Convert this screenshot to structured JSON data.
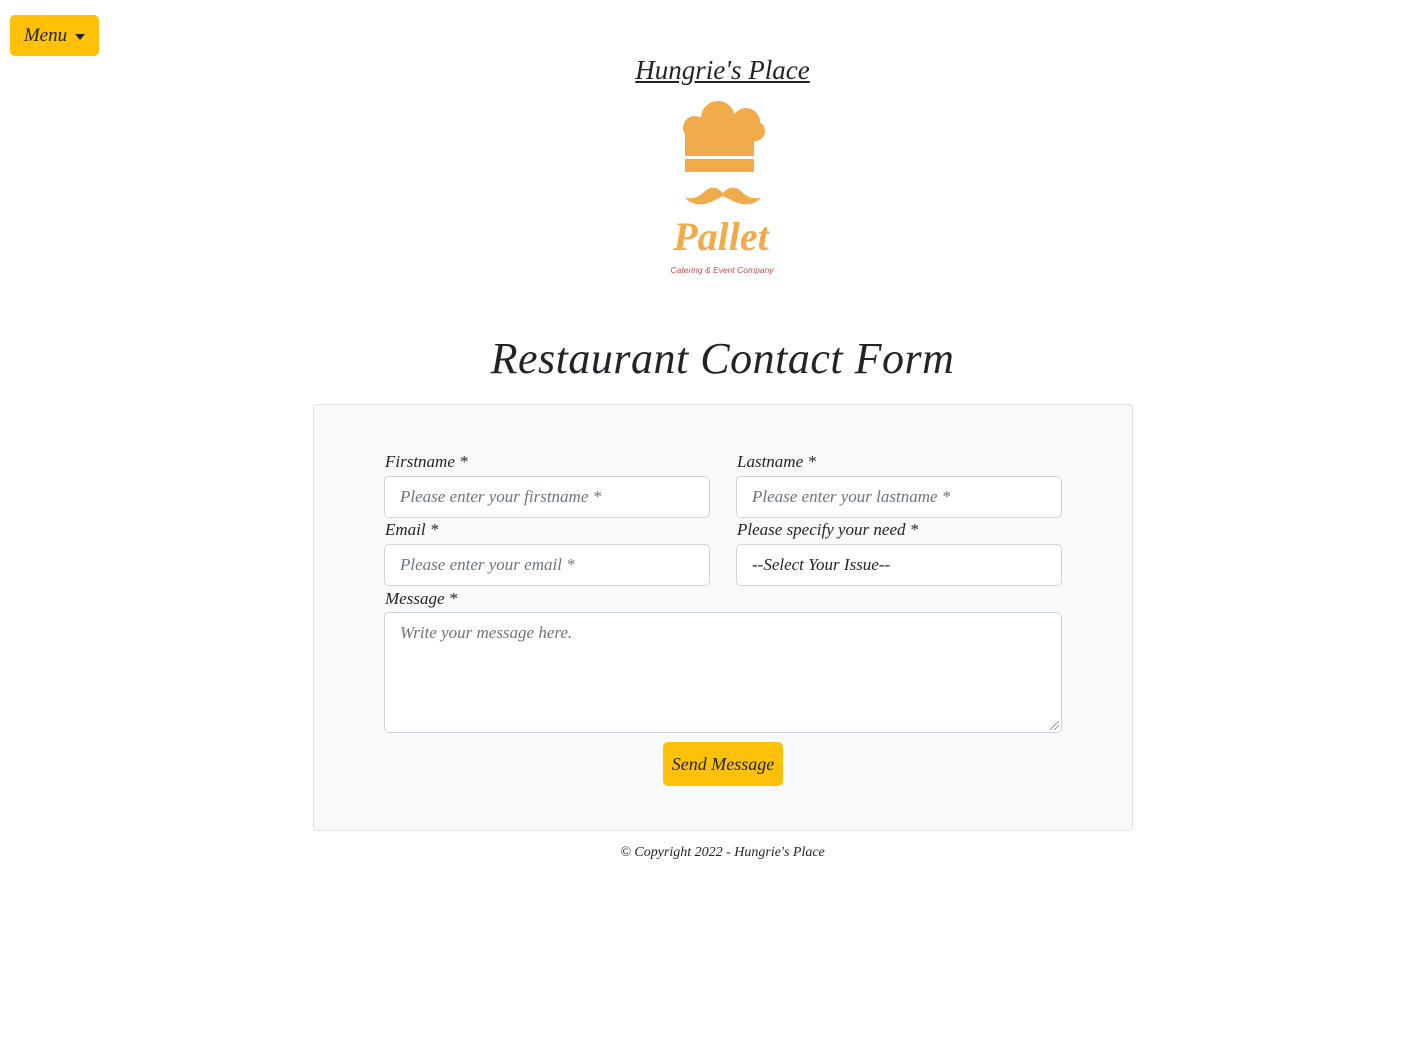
{
  "menu": {
    "label": "Menu"
  },
  "header": {
    "title": "Hungrie's Place",
    "logo": {
      "brand": "Pallet",
      "tagline": "Catering & Event Company",
      "color": "#f0ab4a"
    }
  },
  "form": {
    "heading": "Restaurant Contact Form",
    "fields": {
      "firstname": {
        "label": "Firstname *",
        "placeholder": "Please enter your firstname *"
      },
      "lastname": {
        "label": "Lastname *",
        "placeholder": "Please enter your lastname *"
      },
      "email": {
        "label": "Email *",
        "placeholder": "Please enter your email *"
      },
      "need": {
        "label": "Please specify your need *",
        "selected": "--Select Your Issue--"
      },
      "message": {
        "label": "Message *",
        "placeholder": "Write your message here."
      }
    },
    "submit_label": "Send Message"
  },
  "footer": {
    "copyright": "© Copyright 2022 - Hungrie's Place"
  },
  "colors": {
    "accent": "#ffc107",
    "card_bg": "#f8f9fa"
  }
}
